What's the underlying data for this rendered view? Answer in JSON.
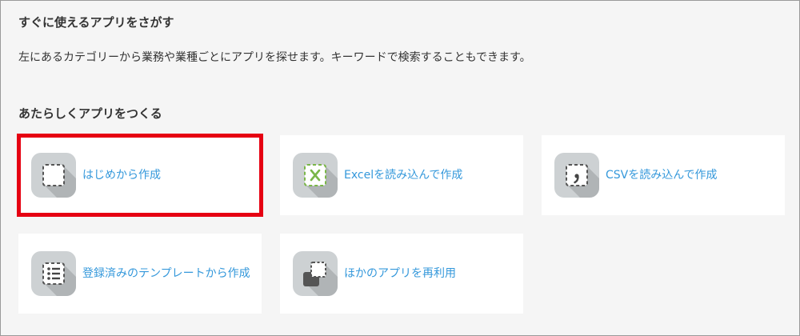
{
  "header": {
    "title": "すぐに使えるアプリをさがす",
    "description": "左にあるカテゴリーから業務や業種ごとにアプリを探せます。キーワードで検索することもできます。"
  },
  "create": {
    "heading": "あたらしくアプリをつくる",
    "options": [
      {
        "label": "はじめから作成",
        "icon": "blank-app-icon",
        "selected": true
      },
      {
        "label": "Excelを読み込んで作成",
        "icon": "excel-import-icon",
        "selected": false
      },
      {
        "label": "CSVを読み込んで作成",
        "icon": "csv-import-icon",
        "selected": false
      },
      {
        "label": "登録済みのテンプレートから作成",
        "icon": "template-list-icon",
        "selected": false
      },
      {
        "label": "ほかのアプリを再利用",
        "icon": "reuse-app-icon",
        "selected": false
      }
    ]
  },
  "colors": {
    "link": "#3498db",
    "highlight": "#e60012",
    "excel_green": "#7ab648"
  }
}
